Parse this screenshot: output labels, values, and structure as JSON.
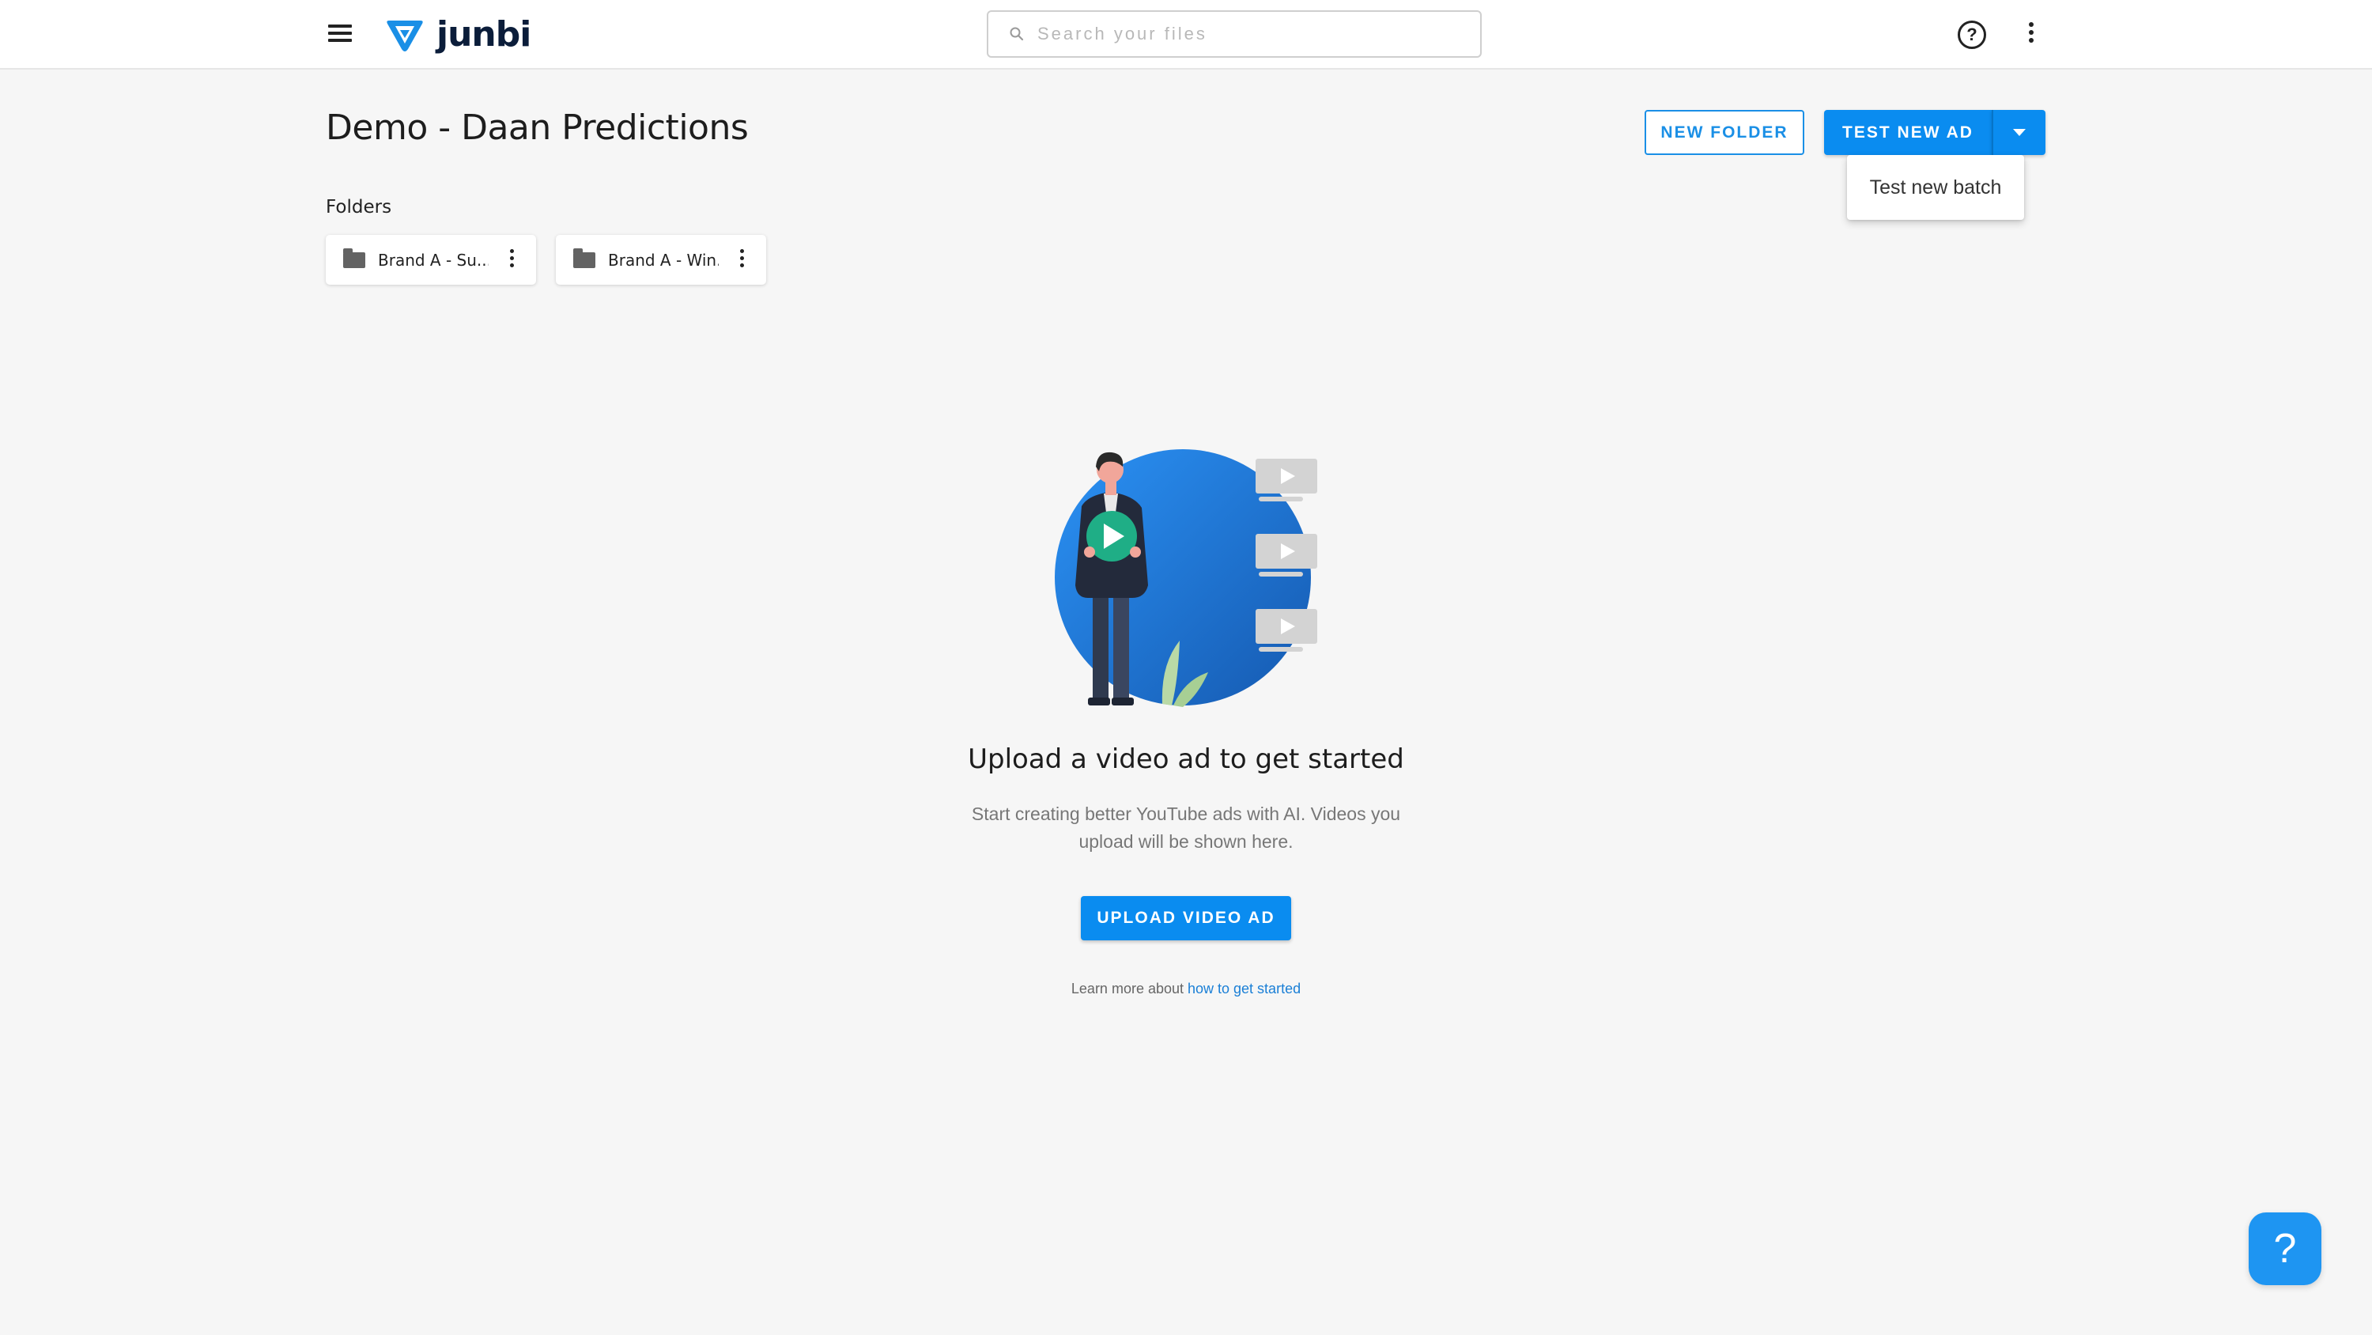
{
  "app": {
    "name": "junbi",
    "accent_color": "#0a8cf0",
    "logo_color": "#1a8fe6"
  },
  "topbar": {
    "menu_icon": "hamburger-menu-icon",
    "search_placeholder": "Search your files",
    "search_value": "",
    "search_icon": "search-icon",
    "help_icon": "help-circle-icon",
    "help_glyph": "?",
    "more_icon": "vertical-dots-icon"
  },
  "page": {
    "title": "Demo - Daan Predictions"
  },
  "actions": {
    "new_folder_label": "NEW FOLDER",
    "test_new_ad_label": "TEST NEW AD",
    "dropdown_icon": "caret-down-icon",
    "dropdown_open": true,
    "dropdown_items": [
      {
        "label": "Test new batch"
      }
    ]
  },
  "folders": {
    "label": "Folders",
    "items": [
      {
        "name": "Brand A - Su...",
        "icon": "folder-icon",
        "menu_icon": "vertical-dots-icon"
      },
      {
        "name": "Brand A - Win...",
        "icon": "folder-icon",
        "menu_icon": "vertical-dots-icon"
      }
    ]
  },
  "empty_state": {
    "illustration": "person-with-video-illustration",
    "heading": "Upload a video ad to get started",
    "description_line1": "Start creating better YouTube ads with AI. Videos you",
    "description_line2": "upload will be shown here.",
    "upload_label": "UPLOAD VIDEO AD",
    "learn_more_prefix": "Learn more about ",
    "learn_more_link": "how to get started"
  },
  "support": {
    "help_bubble_glyph": "?",
    "help_bubble_icon": "question-mark-icon",
    "bubble_color": "#1e95f2"
  }
}
